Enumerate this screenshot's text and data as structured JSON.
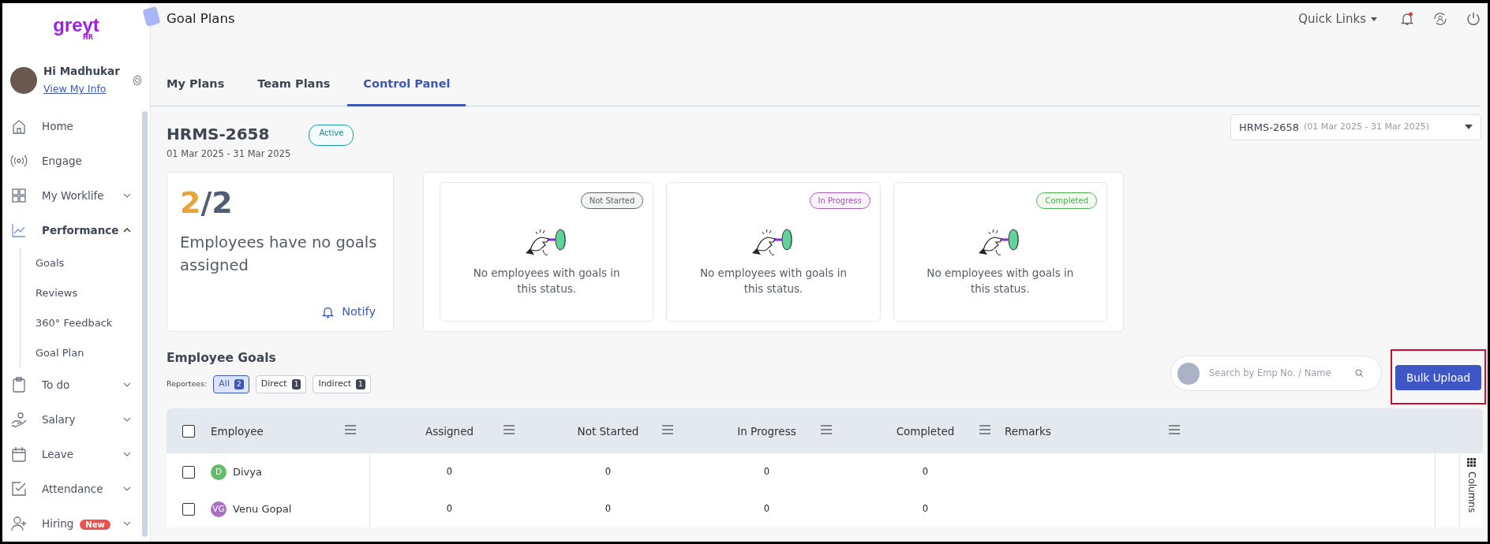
{
  "sidebar": {
    "logo": {
      "wordmark": "greyt",
      "suffix": "HR"
    },
    "profile": {
      "greeting": "Hi Madhukar",
      "link": "View My Info"
    },
    "items": [
      {
        "label": "Home",
        "kind": "link"
      },
      {
        "label": "Engage",
        "kind": "link"
      },
      {
        "label": "My Worklife",
        "kind": "group",
        "expanded": false
      },
      {
        "label": "Performance",
        "kind": "group",
        "expanded": true,
        "children": [
          {
            "label": "Goals"
          },
          {
            "label": "Reviews"
          },
          {
            "label": "360° Feedback"
          },
          {
            "label": "Goal Plan"
          }
        ]
      },
      {
        "label": "To do",
        "kind": "group",
        "expanded": false
      },
      {
        "label": "Salary",
        "kind": "group",
        "expanded": false
      },
      {
        "label": "Leave",
        "kind": "group",
        "expanded": false
      },
      {
        "label": "Attendance",
        "kind": "group",
        "expanded": false
      },
      {
        "label": "Hiring",
        "kind": "group",
        "expanded": false,
        "badge": "New"
      }
    ]
  },
  "header": {
    "title": "Goal Plans",
    "quick_links": "Quick Links",
    "notification_dot": true
  },
  "tabs": [
    {
      "label": "My Plans",
      "selected": false
    },
    {
      "label": "Team Plans",
      "selected": false
    },
    {
      "label": "Control Panel",
      "selected": true
    }
  ],
  "plan": {
    "name": "HRMS-2658",
    "status": "Active",
    "dates": "01 Mar 2025 - 31 Mar 2025",
    "picker": {
      "value": "HRMS-2658",
      "range": "(01 Mar 2025 - 31 Mar 2025)"
    }
  },
  "summary": {
    "count": "2",
    "separator": "/",
    "total": "2",
    "message": "Employees have no goals assigned",
    "action": "Notify"
  },
  "statuses": [
    {
      "label": "Not Started",
      "color": "#5f6368",
      "message": "No employees with goals in this status."
    },
    {
      "label": "In Progress",
      "color": "#a45ab8",
      "message": "No employees with goals in this status."
    },
    {
      "label": "Completed",
      "color": "#4caf50",
      "message": "No employees with goals in this status."
    }
  ],
  "employee_goals": {
    "title": "Employee Goals",
    "filter_label": "Reportees:",
    "filters": [
      {
        "label": "All",
        "count": "2",
        "selected": true
      },
      {
        "label": "Direct",
        "count": "1",
        "selected": false
      },
      {
        "label": "Indirect",
        "count": "1",
        "selected": false
      }
    ],
    "search": {
      "placeholder": "Search by Emp No. / Name"
    },
    "bulk_upload": {
      "label": "Bulk Upload",
      "highlighted": true
    }
  },
  "table": {
    "select_all_checked": false,
    "columns": [
      "Employee",
      "Assigned",
      "Not Started",
      "In Progress",
      "Completed",
      "Remarks"
    ],
    "rows": [
      {
        "initials": "D",
        "color": "#66bb6a",
        "name": "Divya",
        "checked": false,
        "values": [
          "0",
          "0",
          "0",
          "0"
        ]
      },
      {
        "initials": "VG",
        "color": "#ab6fc4",
        "name": "Venu Gopal",
        "checked": false,
        "values": [
          "0",
          "0",
          "0",
          "0"
        ]
      }
    ],
    "columns_panel": "Columns"
  }
}
